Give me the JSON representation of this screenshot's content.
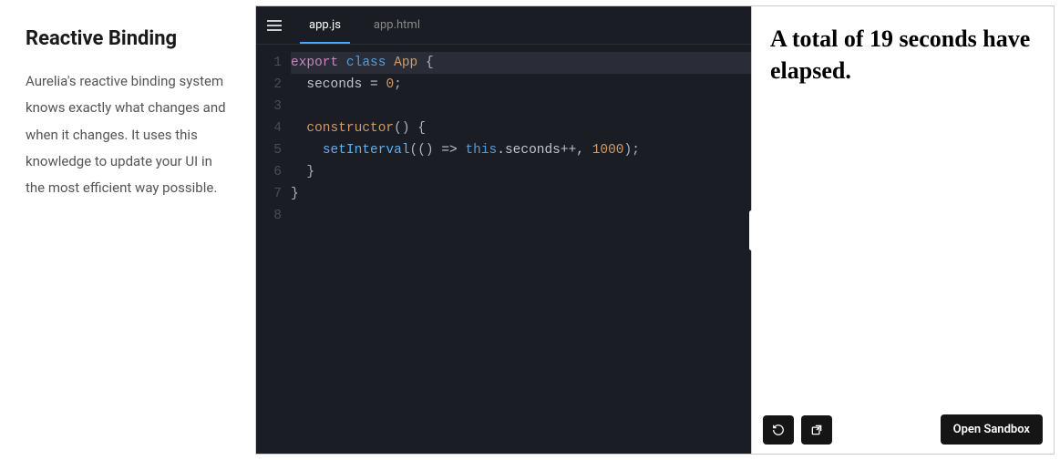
{
  "sidebar": {
    "title": "Reactive Binding",
    "description": "Aurelia's reactive binding system knows exactly what changes and when it changes. It uses this knowledge to update your UI in the most efficient way possible."
  },
  "editor": {
    "tabs": [
      {
        "label": "app.js",
        "active": true
      },
      {
        "label": "app.html",
        "active": false
      }
    ],
    "code": {
      "lines": [
        {
          "n": 1,
          "tokens": [
            [
              "k1",
              "export"
            ],
            [
              "sp",
              " "
            ],
            [
              "k2",
              "class"
            ],
            [
              "sp",
              " "
            ],
            [
              "cls",
              "App"
            ],
            [
              "sp",
              " "
            ],
            [
              "pn",
              "{"
            ]
          ]
        },
        {
          "n": 2,
          "tokens": [
            [
              "sp",
              "  "
            ],
            [
              "op",
              "seconds"
            ],
            [
              "sp",
              " "
            ],
            [
              "op",
              "="
            ],
            [
              "sp",
              " "
            ],
            [
              "num",
              "0"
            ],
            [
              "pn",
              ";"
            ]
          ]
        },
        {
          "n": 3,
          "tokens": []
        },
        {
          "n": 4,
          "tokens": [
            [
              "sp",
              "  "
            ],
            [
              "cls",
              "constructor"
            ],
            [
              "pn",
              "()"
            ],
            [
              "sp",
              " "
            ],
            [
              "pn",
              "{"
            ]
          ]
        },
        {
          "n": 5,
          "tokens": [
            [
              "sp",
              "    "
            ],
            [
              "fn",
              "setInterval"
            ],
            [
              "pn",
              "(()"
            ],
            [
              "sp",
              " "
            ],
            [
              "op",
              "=>"
            ],
            [
              "sp",
              " "
            ],
            [
              "k2",
              "this"
            ],
            [
              "op",
              ".seconds++,"
            ],
            [
              "sp",
              " "
            ],
            [
              "num",
              "1000"
            ],
            [
              "pn",
              ");"
            ]
          ]
        },
        {
          "n": 6,
          "tokens": [
            [
              "sp",
              "  "
            ],
            [
              "pn",
              "}"
            ]
          ]
        },
        {
          "n": 7,
          "tokens": [
            [
              "pn",
              "}"
            ]
          ]
        },
        {
          "n": 8,
          "tokens": []
        }
      ],
      "highlight_line": 1
    }
  },
  "preview": {
    "seconds": 19,
    "text_before": "A total of ",
    "text_after": " seconds have elapsed.",
    "toolbar": {
      "refresh_title": "Refresh",
      "open_window_title": "Open in new window",
      "open_sandbox_label": "Open Sandbox"
    }
  }
}
